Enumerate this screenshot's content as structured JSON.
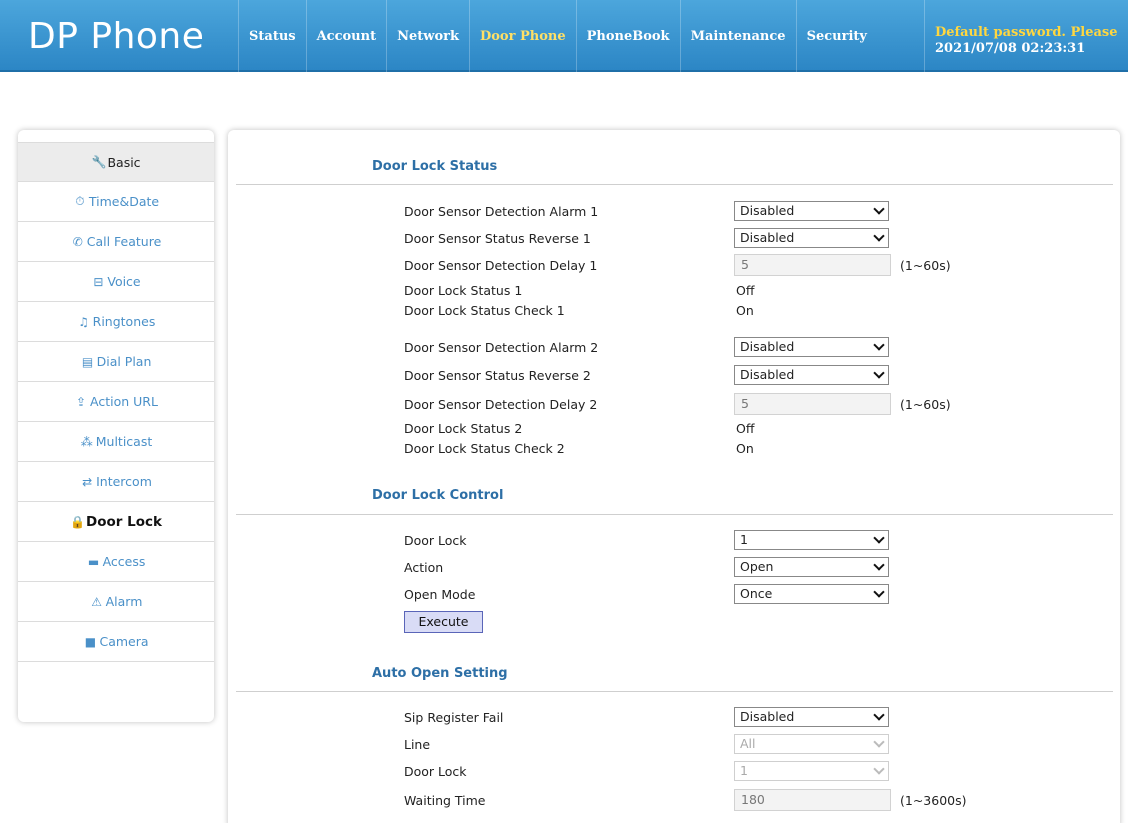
{
  "header": {
    "logo": "DP Phone",
    "nav": [
      "Status",
      "Account",
      "Network",
      "Door Phone",
      "PhoneBook",
      "Maintenance",
      "Security"
    ],
    "active_nav": "Door Phone",
    "warning": "Default password. Please",
    "datetime": "2021/07/08 02:23:31"
  },
  "sidebar": {
    "items": [
      {
        "label": "Basic",
        "icon": "wrench-icon",
        "glyph": "🔧"
      },
      {
        "label": "Time&Date",
        "icon": "clock-icon",
        "glyph": "⏱"
      },
      {
        "label": "Call Feature",
        "icon": "phone-icon",
        "glyph": "✆"
      },
      {
        "label": "Voice",
        "icon": "voice-icon",
        "glyph": "⊟"
      },
      {
        "label": "Ringtones",
        "icon": "bell-icon",
        "glyph": "♫"
      },
      {
        "label": "Dial Plan",
        "icon": "dialplan-icon",
        "glyph": "▤"
      },
      {
        "label": "Action URL",
        "icon": "upload-icon",
        "glyph": "⇪"
      },
      {
        "label": "Multicast",
        "icon": "multicast-icon",
        "glyph": "⁂"
      },
      {
        "label": "Intercom",
        "icon": "swap-icon",
        "glyph": "⇄"
      },
      {
        "label": "Door Lock",
        "icon": "lock-icon",
        "glyph": "🔒"
      },
      {
        "label": "Access",
        "icon": "card-icon",
        "glyph": "▬"
      },
      {
        "label": "Alarm",
        "icon": "warning-icon",
        "glyph": "⚠"
      },
      {
        "label": "Camera",
        "icon": "camera-icon",
        "glyph": "■"
      }
    ],
    "active": "Door Lock"
  },
  "door_lock_status": {
    "title": "Door Lock Status",
    "alarm1_label": "Door Sensor Detection Alarm 1",
    "alarm1_value": "Disabled",
    "reverse1_label": "Door Sensor Status Reverse 1",
    "reverse1_value": "Disabled",
    "delay1_label": "Door Sensor Detection Delay 1",
    "delay1_value": "5",
    "delay1_hint": "(1~60s)",
    "status1_label": "Door Lock Status 1",
    "status1_value": "Off",
    "check1_label": "Door Lock Status Check 1",
    "check1_value": "On",
    "alarm2_label": "Door Sensor Detection Alarm 2",
    "alarm2_value": "Disabled",
    "reverse2_label": "Door Sensor Status Reverse 2",
    "reverse2_value": "Disabled",
    "delay2_label": "Door Sensor Detection Delay 2",
    "delay2_value": "5",
    "delay2_hint": "(1~60s)",
    "status2_label": "Door Lock Status 2",
    "status2_value": "Off",
    "check2_label": "Door Lock Status Check 2",
    "check2_value": "On"
  },
  "door_lock_control": {
    "title": "Door Lock Control",
    "lock_label": "Door Lock",
    "lock_value": "1",
    "action_label": "Action",
    "action_value": "Open",
    "mode_label": "Open Mode",
    "mode_value": "Once",
    "execute_label": "Execute"
  },
  "auto_open": {
    "title": "Auto Open Setting",
    "sip_label": "Sip Register Fail",
    "sip_value": "Disabled",
    "line_label": "Line",
    "line_value": "All",
    "lock_label": "Door Lock",
    "lock_value": "1",
    "wait_label": "Waiting Time",
    "wait_value": "180",
    "wait_hint": "(1~3600s)"
  },
  "colors": {
    "header": "#2c86c5",
    "warning": "#ffd740",
    "active_nav": "#ffe066",
    "section_title": "#2d6fa6",
    "sidebar_link": "#4a90c8",
    "button": "#d9dcf6"
  }
}
